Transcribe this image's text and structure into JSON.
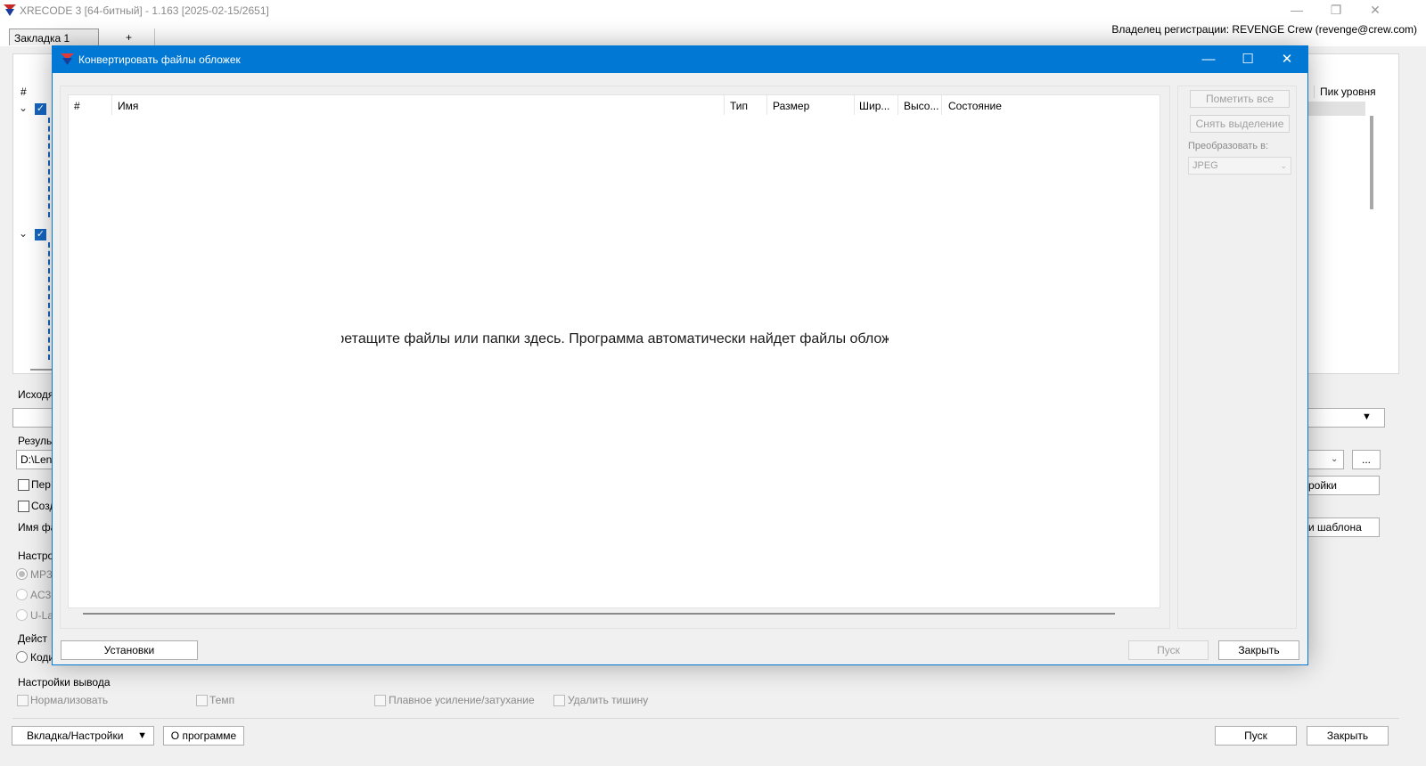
{
  "app": {
    "title": "XRECODE 3 [64-битный] - 1.163 [2025-02-15/2651]",
    "owner": "Владелец регистрации: REVENGE Crew (revenge@crew.com)",
    "tabs": [
      {
        "label": "Закладка 1"
      },
      {
        "label": "+"
      }
    ],
    "window_controls": {
      "minimize": "—",
      "restore": "❐",
      "close": "✕"
    }
  },
  "main": {
    "column_hash": "#",
    "column_peak": "Пик уровня",
    "source_label": "Исходя",
    "result_label": "Резуль",
    "result_path": "D:\\Len",
    "option_per": "Пер",
    "option_create": "Созд",
    "filename_label": "Имя фа",
    "settings_btn": "ройки",
    "template_btn": "и шаблона",
    "browse_btn": "...",
    "format_section": "Настро",
    "format_mp3": "MP3",
    "format_ac3": "AC3",
    "format_ulaw": "U-La",
    "action_section": "Дейст",
    "action_encode": "Коди",
    "output_settings": {
      "label": "Настройки вывода",
      "normalize": "Нормализовать",
      "tempo": "Темп",
      "fade": "Плавное усиление/затухание",
      "silence": "Удалить тишину"
    },
    "bottom": {
      "tab_settings": "Вкладка/Настройки",
      "about": "О программе",
      "start": "Пуск",
      "close": "Закрыть"
    }
  },
  "dialog": {
    "title": "Конвертировать файлы обложек",
    "controls": {
      "minimize": "—",
      "maximize": "☐",
      "close": "✕"
    },
    "columns": {
      "num": "#",
      "name": "Имя",
      "type": "Тип",
      "size": "Размер",
      "width": "Шир...",
      "height": "Высо...",
      "status": "Состояние"
    },
    "drop_hint": "Перетащите файлы или папки здесь. Программа автоматически найдет файлы обложек.",
    "side": {
      "select_all": "Пометить все",
      "deselect": "Снять выделение",
      "convert_to_label": "Преобразовать в:",
      "format": "JPEG"
    },
    "buttons": {
      "settings": "Установки",
      "start": "Пуск",
      "close": "Закрыть"
    }
  }
}
